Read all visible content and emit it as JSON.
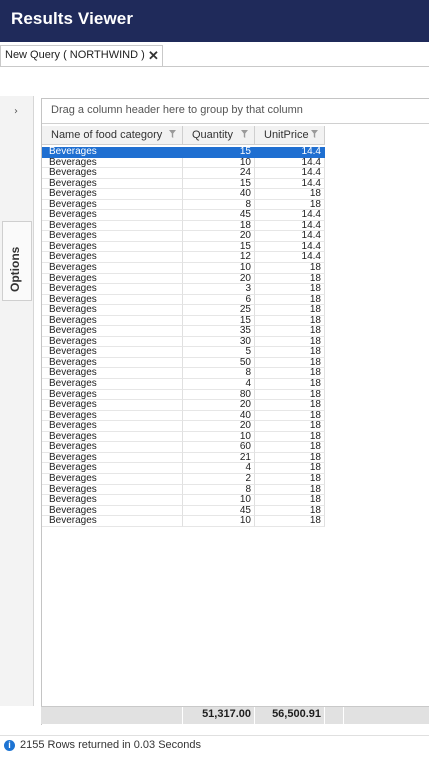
{
  "window": {
    "title": "Results Viewer"
  },
  "tab": {
    "label": "New Query  ( NORTHWIND )",
    "close_glyph": "✕"
  },
  "options_panel": {
    "label": "Options",
    "chevron": "›"
  },
  "grid": {
    "group_hint": "Drag a column header here to group by that column",
    "columns": [
      "Name of food category",
      "Quantity",
      "UnitPrice"
    ],
    "rows": [
      [
        "Beverages",
        "15",
        "14.4"
      ],
      [
        "Beverages",
        "10",
        "14.4"
      ],
      [
        "Beverages",
        "24",
        "14.4"
      ],
      [
        "Beverages",
        "15",
        "14.4"
      ],
      [
        "Beverages",
        "40",
        "18"
      ],
      [
        "Beverages",
        "8",
        "18"
      ],
      [
        "Beverages",
        "45",
        "14.4"
      ],
      [
        "Beverages",
        "18",
        "14.4"
      ],
      [
        "Beverages",
        "20",
        "14.4"
      ],
      [
        "Beverages",
        "15",
        "14.4"
      ],
      [
        "Beverages",
        "12",
        "14.4"
      ],
      [
        "Beverages",
        "10",
        "18"
      ],
      [
        "Beverages",
        "20",
        "18"
      ],
      [
        "Beverages",
        "3",
        "18"
      ],
      [
        "Beverages",
        "6",
        "18"
      ],
      [
        "Beverages",
        "25",
        "18"
      ],
      [
        "Beverages",
        "15",
        "18"
      ],
      [
        "Beverages",
        "35",
        "18"
      ],
      [
        "Beverages",
        "30",
        "18"
      ],
      [
        "Beverages",
        "5",
        "18"
      ],
      [
        "Beverages",
        "50",
        "18"
      ],
      [
        "Beverages",
        "8",
        "18"
      ],
      [
        "Beverages",
        "4",
        "18"
      ],
      [
        "Beverages",
        "80",
        "18"
      ],
      [
        "Beverages",
        "20",
        "18"
      ],
      [
        "Beverages",
        "40",
        "18"
      ],
      [
        "Beverages",
        "20",
        "18"
      ],
      [
        "Beverages",
        "10",
        "18"
      ],
      [
        "Beverages",
        "60",
        "18"
      ],
      [
        "Beverages",
        "21",
        "18"
      ],
      [
        "Beverages",
        "4",
        "18"
      ],
      [
        "Beverages",
        "2",
        "18"
      ],
      [
        "Beverages",
        "8",
        "18"
      ],
      [
        "Beverages",
        "10",
        "18"
      ],
      [
        "Beverages",
        "45",
        "18"
      ],
      [
        "Beverages",
        "10",
        "18"
      ]
    ],
    "selected_row": 0,
    "totals": {
      "quantity": "51,317.00",
      "unit_price": "56,500.91"
    }
  },
  "status": {
    "message": "2155 Rows returned in 0.03 Seconds",
    "icon": "info-icon"
  },
  "colors": {
    "titlebar": "#1f2a5a",
    "selection": "#1f6fd1",
    "info": "#1d74d3"
  }
}
